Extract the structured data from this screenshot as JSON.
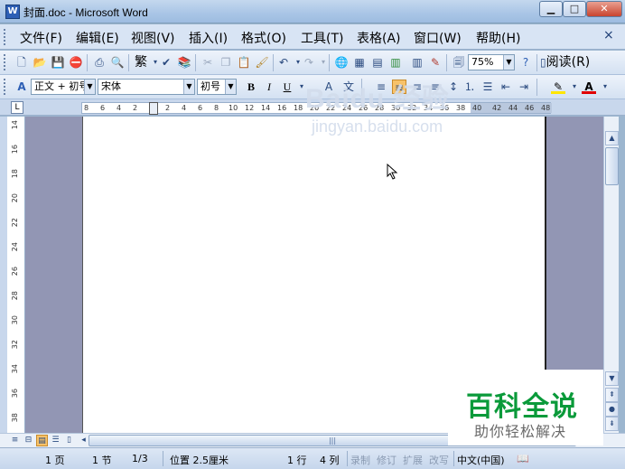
{
  "window": {
    "title": "封面.doc - Microsoft Word",
    "controls": {
      "minimize": "▁",
      "maximize": "□",
      "close": "✕"
    }
  },
  "menubar": {
    "items": [
      {
        "label": "文件(F)"
      },
      {
        "label": "编辑(E)"
      },
      {
        "label": "视图(V)"
      },
      {
        "label": "插入(I)"
      },
      {
        "label": "格式(O)"
      },
      {
        "label": "工具(T)"
      },
      {
        "label": "表格(A)"
      },
      {
        "label": "窗口(W)"
      },
      {
        "label": "帮助(H)"
      }
    ],
    "close_doc": "×"
  },
  "standard_toolbar": {
    "traditional_label": "繁",
    "zoom": "75%",
    "read_label": "阅读(R)",
    "icons": [
      "new-icon",
      "open-icon",
      "save-icon",
      "permission-icon",
      "print-icon",
      "print-preview-icon",
      "traditional-icon",
      "research-icon",
      "cut-icon",
      "copy-icon",
      "paste-icon",
      "format-painter-icon",
      "undo-icon",
      "redo-icon",
      "hyperlink-icon",
      "tables-borders-icon",
      "insert-table-icon",
      "insert-excel-icon",
      "columns-icon",
      "drawing-icon",
      "document-map-icon",
      "show-hide-icon",
      "help-icon"
    ]
  },
  "format_toolbar": {
    "style": "正文 + 初号",
    "font": "宋体",
    "size": "初号",
    "bold": "B",
    "italic": "I",
    "underline": "U",
    "font_color_letter": "A"
  },
  "ruler": {
    "tab_selector": "L",
    "h_ticks": [
      "8",
      "6",
      "4",
      "2",
      "2",
      "4",
      "6",
      "8",
      "10",
      "12",
      "14",
      "16",
      "18",
      "20",
      "22",
      "24",
      "26",
      "28",
      "30",
      "32",
      "34",
      "36",
      "38",
      "40",
      "42",
      "44",
      "46",
      "48"
    ],
    "v_ticks": [
      "14",
      "16",
      "18",
      "20",
      "22",
      "24",
      "26",
      "28",
      "30",
      "32",
      "34",
      "36",
      "38"
    ]
  },
  "watermark": {
    "main": "Baidu 经验",
    "sub": "jingyan.baidu.com"
  },
  "statusbar": {
    "page": "1 页",
    "section": "1 节",
    "pages": "1/3",
    "position": "位置 2.5厘米",
    "line": "1 行",
    "column": "4 列",
    "rec": "录制",
    "trk": "修订",
    "ext": "扩展",
    "ovr": "改写",
    "language": "中文(中国)"
  },
  "baike_logo": {
    "title": "百科全说",
    "subtitle": "助你轻松解决"
  }
}
